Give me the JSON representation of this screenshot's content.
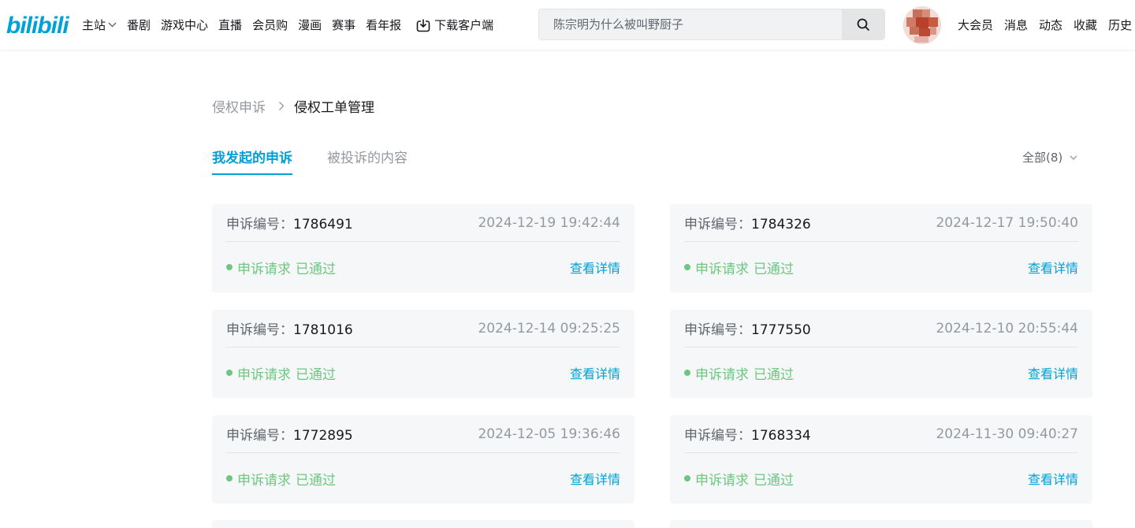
{
  "header": {
    "logo_text": "bilibili",
    "nav": [
      "主站",
      "番剧",
      "游戏中心",
      "直播",
      "会员购",
      "漫画",
      "赛事",
      "看年报"
    ],
    "download_label": "下载客户端",
    "search_placeholder": "陈宗明为什么被叫野厨子",
    "right_nav": [
      "大会员",
      "消息",
      "动态",
      "收藏",
      "历史"
    ]
  },
  "breadcrumb": {
    "parent": "侵权申诉",
    "current": "侵权工单管理"
  },
  "tabs": [
    "我发起的申诉",
    "被投诉的内容"
  ],
  "filter_label": "全部(8)",
  "card_labels": {
    "id_label": "申诉编号：",
    "status_prefix": "申诉请求",
    "detail_label": "查看详情"
  },
  "cards": [
    {
      "id": "1786491",
      "time": "2024-12-19 19:42:44",
      "status": "已通过"
    },
    {
      "id": "1784326",
      "time": "2024-12-17 19:50:40",
      "status": "已通过"
    },
    {
      "id": "1781016",
      "time": "2024-12-14 09:25:25",
      "status": "已通过"
    },
    {
      "id": "1777550",
      "time": "2024-12-10 20:55:44",
      "status": "已通过"
    },
    {
      "id": "1772895",
      "time": "2024-12-05 19:36:46",
      "status": "已通过"
    },
    {
      "id": "1768334",
      "time": "2024-11-30 09:40:27",
      "status": "已通过"
    }
  ],
  "colors": {
    "accent": "#00a1d6",
    "success": "#6dc781",
    "card_bg": "#f6f7f8"
  }
}
